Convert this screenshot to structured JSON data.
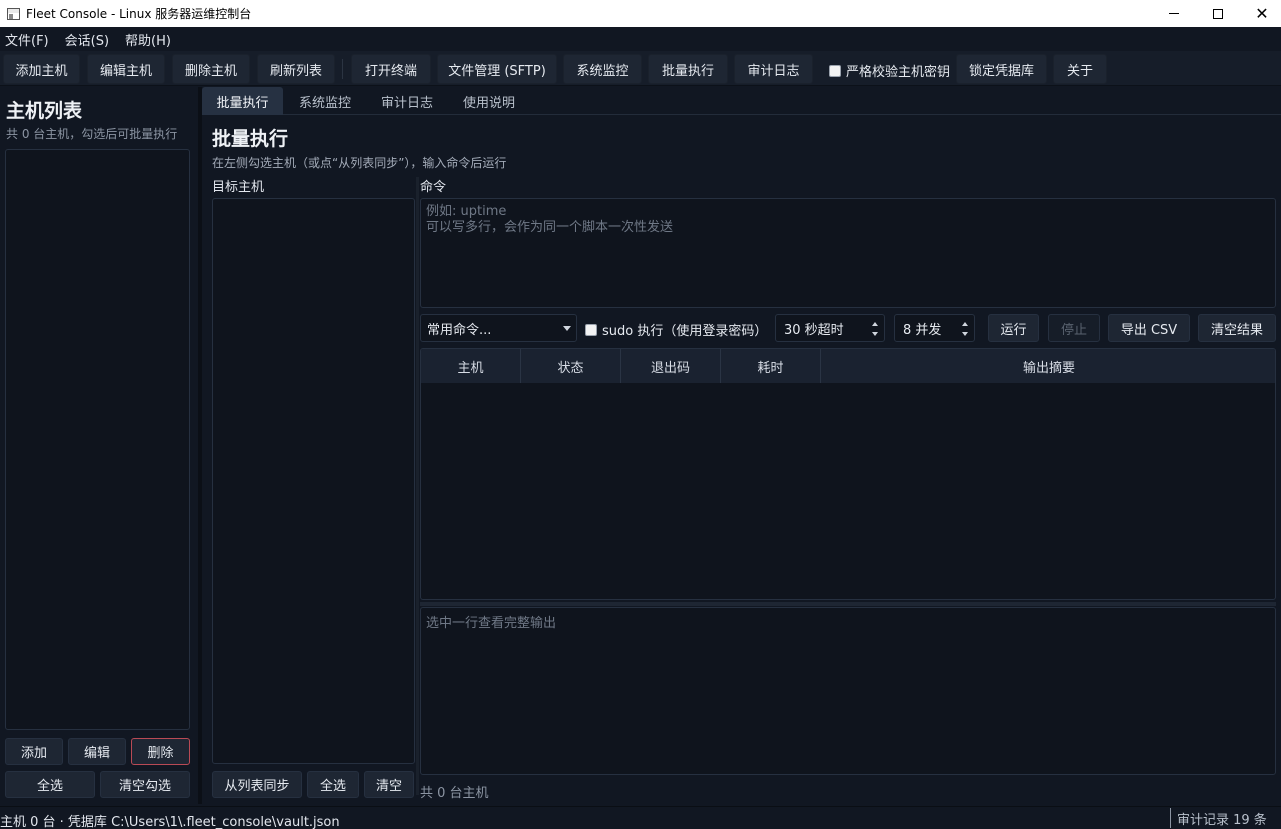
{
  "window": {
    "title": "Fleet Console - Linux 服务器运维控制台",
    "minimize": "—",
    "maximize": "□",
    "close": "✕"
  },
  "menu": [
    "文件(F)",
    "会话(S)",
    "帮助(H)"
  ],
  "toolbar": {
    "add_host": "添加主机",
    "edit_host": "编辑主机",
    "delete_host": "删除主机",
    "refresh_list": "刷新列表",
    "open_terminal": "打开终端",
    "file_manager": "文件管理 (SFTP)",
    "system_monitor": "系统监控",
    "batch_exec": "批量执行",
    "audit_log": "审计日志",
    "strict_host_key": "严格校验主机密钥",
    "lock_vault": "锁定凭据库",
    "about": "关于"
  },
  "sidebar": {
    "title": "主机列表",
    "subtitle": "共 0 台主机，勾选后可批量执行",
    "add": "添加",
    "edit": "编辑",
    "delete": "删除",
    "select_all": "全选",
    "clear_checks": "清空勾选"
  },
  "tabs": [
    "批量执行",
    "系统监控",
    "审计日志",
    "使用说明"
  ],
  "batch": {
    "title": "批量执行",
    "subtitle": "在左侧勾选主机（或点“从列表同步”），输入命令后运行",
    "targets_label": "目标主机",
    "command_label": "命令",
    "command_placeholder": "例如: uptime\n可以写多行，会作为同一个脚本一次性发送",
    "common_commands": "常用命令...",
    "sudo_label": "sudo 执行（使用登录密码）",
    "timeout": "30 秒超时",
    "concurrency": "8 并发",
    "run": "运行",
    "stop": "停止",
    "export_csv": "导出 CSV",
    "clear_results": "清空结果",
    "columns": [
      "主机",
      "状态",
      "退出码",
      "耗时",
      "输出摘要"
    ],
    "output_placeholder": "选中一行查看完整输出",
    "sync_from_list": "从列表同步",
    "select_all": "全选",
    "clear": "清空",
    "host_count": "共 0 台主机"
  },
  "status": {
    "left": "主机 0 台 · 凭据库 C:\\Users\\1\\.fleet_console\\vault.json",
    "right": "审计记录 19 条"
  }
}
